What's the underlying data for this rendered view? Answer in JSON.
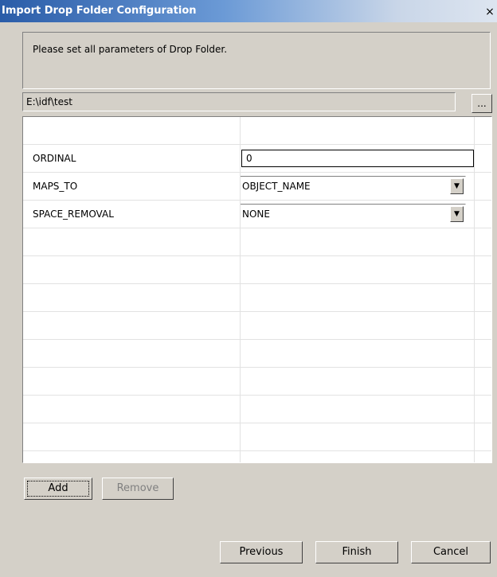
{
  "window": {
    "title": "Import Drop Folder Configuration",
    "close_glyph": "×"
  },
  "description": "Please set all parameters of Drop Folder.",
  "path": {
    "value": "E:\\idf\\test",
    "browse_label": "..."
  },
  "parameters": [
    {
      "name": "ORDINAL",
      "value": "0",
      "control": "text"
    },
    {
      "name": "MAPS_TO",
      "value": "OBJECT_NAME",
      "control": "dropdown"
    },
    {
      "name": "SPACE_REMOVAL",
      "value": "NONE",
      "control": "dropdown"
    }
  ],
  "buttons": {
    "add": "Add",
    "remove": "Remove",
    "previous": "Previous",
    "finish": "Finish",
    "cancel": "Cancel"
  },
  "icons": {
    "dropdown_arrow": "chevron-down-icon",
    "close": "close-icon"
  }
}
